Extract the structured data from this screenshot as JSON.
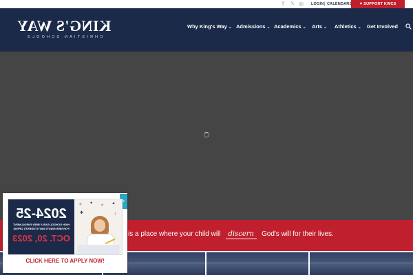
{
  "topbar": {
    "social": [
      {
        "icon": "facebook-icon",
        "glyph": "f"
      },
      {
        "icon": "x-twitter-icon",
        "glyph": "𝕏"
      },
      {
        "icon": "instagram-icon",
        "glyph": "◎"
      }
    ],
    "login_label": "LOGIN",
    "separator": "|",
    "calendars_label": "CALENDARS",
    "support_label": "SUPPORT KWCS"
  },
  "header": {
    "logo_main": "KING'S WAY",
    "logo_sub": "CHRISTIAN SCHOOLS",
    "nav": [
      {
        "label": "Why King's Way",
        "dropdown": true
      },
      {
        "label": "Admissions",
        "dropdown": true
      },
      {
        "label": "Academics",
        "dropdown": true
      },
      {
        "label": "Arts",
        "dropdown": true
      },
      {
        "label": "Athletics",
        "dropdown": true
      },
      {
        "label": "Get Involved",
        "dropdown": false
      }
    ]
  },
  "band": {
    "before": "is a place where your child will",
    "highlight": "discern",
    "after": "God's will for their lives."
  },
  "popup": {
    "close_label": "x",
    "promo_year": "2024-25",
    "promo_line1": "HIGH SCHOOL EARLY BIRD ENROLLMENT",
    "promo_line2": "FOR NEW KING'S WAY STUDENTS OPENS",
    "promo_date": "OCT. 20, 2023",
    "cta_label": "CLICK HERE TO APPLY NOW!"
  },
  "colors": {
    "navy": "#1c2a4a",
    "red": "#c0202e",
    "hero_gray": "#454545",
    "close_teal": "#2aa6c4"
  }
}
